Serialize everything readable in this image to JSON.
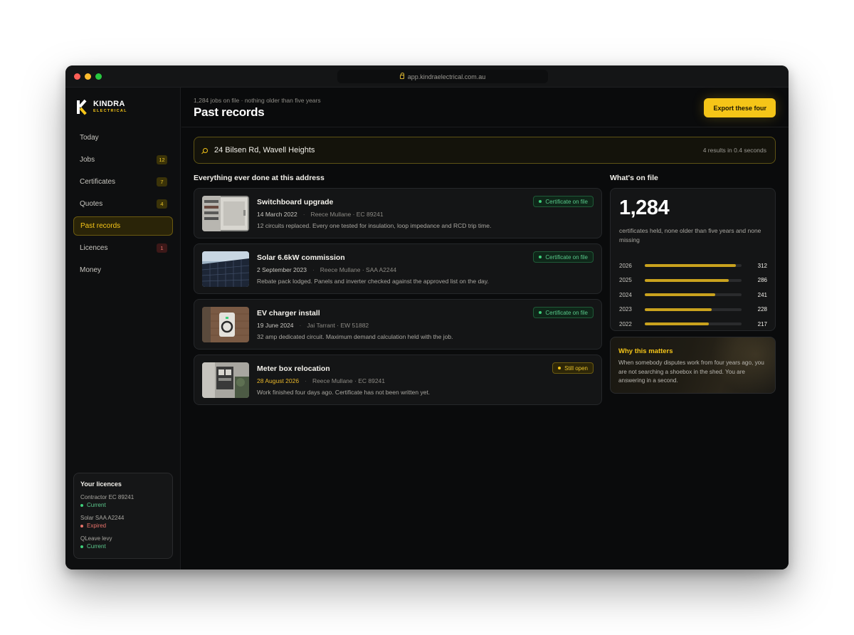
{
  "browser": {
    "url": "app.kindraelectrical.com.au"
  },
  "brand": {
    "name": "KINDRA",
    "sub": "ELECTRICAL"
  },
  "sidebar": {
    "items": [
      {
        "label": "Today",
        "badge": ""
      },
      {
        "label": "Jobs",
        "badge": "12"
      },
      {
        "label": "Certificates",
        "badge": "7"
      },
      {
        "label": "Quotes",
        "badge": "4"
      },
      {
        "label": "Past records",
        "badge": ""
      },
      {
        "label": "Licences",
        "badge": "1"
      },
      {
        "label": "Money",
        "badge": ""
      }
    ],
    "active": "Past records"
  },
  "licences": {
    "title": "Your licences",
    "items": [
      {
        "name": "Contractor EC 89241",
        "status": "Current"
      },
      {
        "name": "Solar SAA A2244",
        "status": "Expired"
      },
      {
        "name": "QLeave levy",
        "status": "Current"
      }
    ]
  },
  "header": {
    "subtitle": "1,284 jobs on file · nothing older than five years",
    "title": "Past records",
    "export_label": "Export these four"
  },
  "search": {
    "value": "24 Bilsen Rd, Wavell Heights",
    "meta": "4 results in 0.4 seconds"
  },
  "records_title": "Everything ever done at this address",
  "records": [
    {
      "title": "Switchboard upgrade",
      "date": "14 March 2022",
      "who": "Reece Mullane · EC 89241",
      "desc": "12 circuits replaced. Every one tested for insulation, loop impedance and RCD trip time.",
      "status": "Certificate on file",
      "thumb": "switchboard-photo"
    },
    {
      "title": "Solar 6.6kW commission",
      "date": "2 September 2023",
      "who": "Reece Mullane · SAA A2244",
      "desc": "Rebate pack lodged. Panels and inverter checked against the approved list on the day.",
      "status": "Certificate on file",
      "thumb": "solar-panel-photo"
    },
    {
      "title": "EV charger install",
      "date": "19 June 2024",
      "who": "Jai Tarrant · EW 51882",
      "desc": "32 amp dedicated circuit. Maximum demand calculation held with the job.",
      "status": "Certificate on file",
      "thumb": "ev-charger-photo"
    },
    {
      "title": "Meter box relocation",
      "date": "28 August 2026",
      "who": "Reece Mullane · EC 89241",
      "desc": "Work finished four days ago. Certificate has not been written yet.",
      "status": "Still open",
      "thumb": "meter-box-photo"
    }
  ],
  "stats": {
    "title": "What's on file",
    "big_number": "1,284",
    "desc": "certificates held, none older than five years and none missing",
    "years": [
      {
        "year": "2026",
        "value": "312",
        "fraction": 0.94
      },
      {
        "year": "2025",
        "value": "286",
        "fraction": 0.87
      },
      {
        "year": "2024",
        "value": "241",
        "fraction": 0.73
      },
      {
        "year": "2023",
        "value": "228",
        "fraction": 0.69
      },
      {
        "year": "2022",
        "value": "217",
        "fraction": 0.66
      }
    ]
  },
  "why": {
    "title": "Why this matters",
    "text": "When somebody disputes work from four years ago, you are not searching a shoebox in the shed. You are answering in a second."
  },
  "colors": {
    "accent": "#f5c518",
    "success": "#3ecf7a",
    "danger": "#e8736b",
    "background": "#0a0b0c"
  }
}
